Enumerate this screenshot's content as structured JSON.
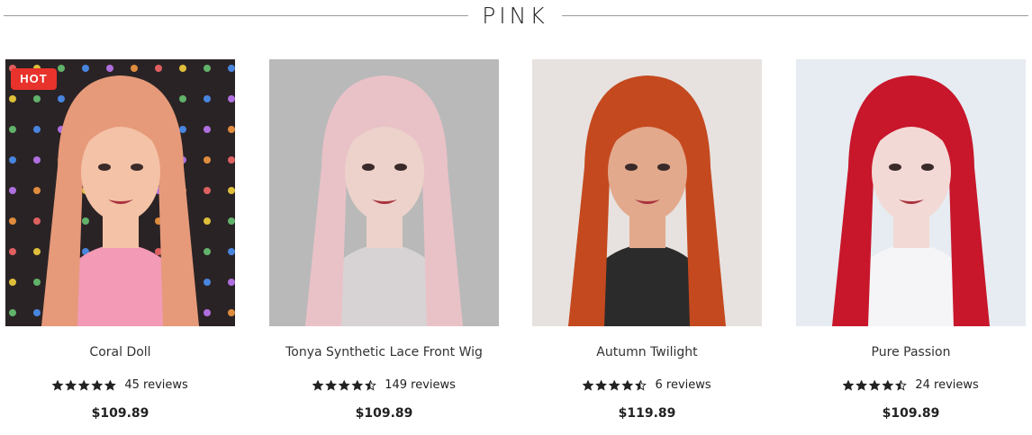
{
  "section": {
    "title": "PINK"
  },
  "products": [
    {
      "name": "Coral Doll",
      "badge": "HOT",
      "rating": 5,
      "reviews_text": "45 reviews",
      "price": "$109.89",
      "image_icon": "product-photo-icon",
      "colors": {
        "hair": "#e69a7a",
        "bg": "#2a2325",
        "top": "#f29ab6",
        "skin": "#f4c2a6"
      }
    },
    {
      "name": "Tonya Synthetic Lace Front Wig",
      "rating": 4.5,
      "reviews_text": "149 reviews",
      "price": "$109.89",
      "image_icon": "product-photo-icon",
      "colors": {
        "hair": "#e9c2c8",
        "bg": "#b9b9b9",
        "top": "#d7d3d5",
        "skin": "#ecd2ca"
      }
    },
    {
      "name": "Autumn Twilight",
      "rating": 4.5,
      "reviews_text": "6 reviews",
      "price": "$119.89",
      "image_icon": "product-photo-icon",
      "colors": {
        "hair": "#c4491f",
        "bg": "#e7e2df",
        "top": "#2b2b2b",
        "skin": "#e3a98c"
      }
    },
    {
      "name": "Pure Passion",
      "rating": 4.5,
      "reviews_text": "24 reviews",
      "price": "$109.89",
      "image_icon": "product-photo-icon",
      "colors": {
        "hair": "#c8162b",
        "bg": "#e6ecf1",
        "top": "#f5f5f7",
        "skin": "#f3d9d5"
      }
    }
  ]
}
